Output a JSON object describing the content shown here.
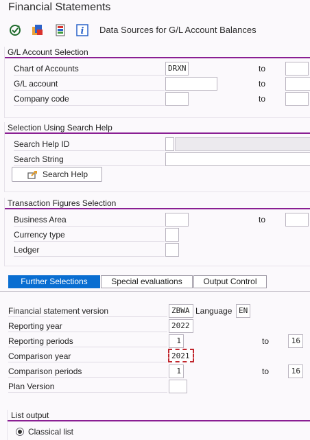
{
  "app": {
    "title": "Financial Statements"
  },
  "toolbar": {
    "data_sources_label": "Data Sources for G/L Account Balances"
  },
  "gl_selection": {
    "title": "G/L Account Selection",
    "chart_of_accounts_label": "Chart of Accounts",
    "chart_of_accounts_value": "DRXN",
    "gl_account_label": "G/L account",
    "company_code_label": "Company code",
    "to_label": "to"
  },
  "search_help": {
    "title": "Selection Using Search Help",
    "id_label": "Search Help ID",
    "string_label": "Search String",
    "button_label": "Search Help"
  },
  "transaction_figures": {
    "title": "Transaction Figures Selection",
    "business_area_label": "Business Area",
    "currency_type_label": "Currency type",
    "ledger_label": "Ledger",
    "to_label": "to"
  },
  "tabs": [
    {
      "label": "Further Selections",
      "active": true
    },
    {
      "label": "Special evaluations",
      "active": false
    },
    {
      "label": "Output Control",
      "active": false
    }
  ],
  "further": {
    "fs_version_label": "Financial statement version",
    "fs_version_value": "ZBWA",
    "language_label": "Language",
    "language_value": "EN",
    "reporting_year_label": "Reporting year",
    "reporting_year_value": "2022",
    "reporting_periods_label": "Reporting periods",
    "reporting_period_from": "1",
    "reporting_period_to": "16",
    "comparison_year_label": "Comparison year",
    "comparison_year_value": "2021",
    "comparison_periods_label": "Comparison periods",
    "comparison_period_from": "1",
    "comparison_period_to": "16",
    "plan_version_label": "Plan Version",
    "to_label": "to"
  },
  "list_output": {
    "title": "List output",
    "classical_list_label": "Classical list"
  },
  "colors": {
    "accent": "#8a1f93",
    "tab_active": "#0a6ed1",
    "focus": "#c0262d"
  }
}
